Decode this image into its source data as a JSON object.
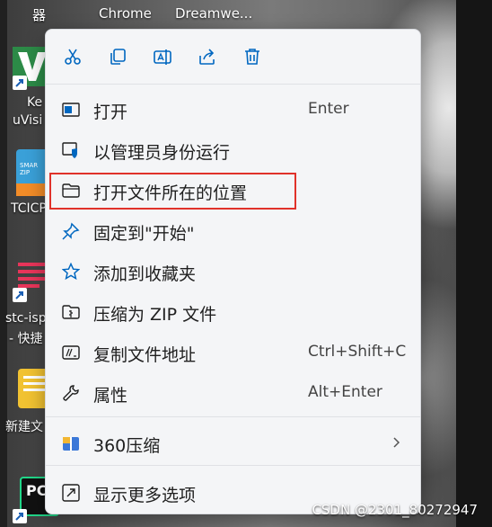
{
  "desktop": {
    "top_labels": [
      "器",
      "Chrome",
      "Dreamwe..."
    ],
    "left_labels": [
      "Ke",
      "uVisi",
      "TCICP",
      "stc-isp",
      "- 快捷",
      "新建文"
    ],
    "zip_icon_text": [
      "SMAR",
      "ZIP"
    ],
    "pc_icon_text": "PC"
  },
  "menu": {
    "toolbar": [
      {
        "name": "cut",
        "icon": "scissors-icon"
      },
      {
        "name": "copy",
        "icon": "copy-icon"
      },
      {
        "name": "rename",
        "icon": "rename-icon"
      },
      {
        "name": "share",
        "icon": "share-icon"
      },
      {
        "name": "delete",
        "icon": "trash-icon"
      }
    ],
    "items": [
      {
        "label": "打开",
        "shortcut": "Enter",
        "icon": "open-window-icon"
      },
      {
        "label": "以管理员身份运行",
        "shortcut": "",
        "icon": "shield-icon"
      },
      {
        "label": "打开文件所在的位置",
        "shortcut": "",
        "icon": "folder-icon"
      },
      {
        "label": "固定到\"开始\"",
        "shortcut": "",
        "icon": "pin-icon"
      },
      {
        "label": "添加到收藏夹",
        "shortcut": "",
        "icon": "star-icon"
      },
      {
        "label": "压缩为 ZIP 文件",
        "shortcut": "",
        "icon": "zip-folder-icon"
      },
      {
        "label": "复制文件地址",
        "shortcut": "Ctrl+Shift+C",
        "icon": "copy-path-icon"
      },
      {
        "label": "属性",
        "shortcut": "Alt+Enter",
        "icon": "wrench-icon"
      },
      {
        "label": "360压缩",
        "shortcut": "",
        "icon": "archive-360-icon",
        "submenu_icon": "chevron-right-icon"
      },
      {
        "label": "显示更多选项",
        "shortcut": "",
        "icon": "more-options-icon"
      }
    ]
  },
  "watermark": "CSDN @2301_80272947",
  "colors": {
    "highlight_border": "#e0322a",
    "accent": "#0067c0",
    "menu_bg": "#f4f5f7"
  }
}
